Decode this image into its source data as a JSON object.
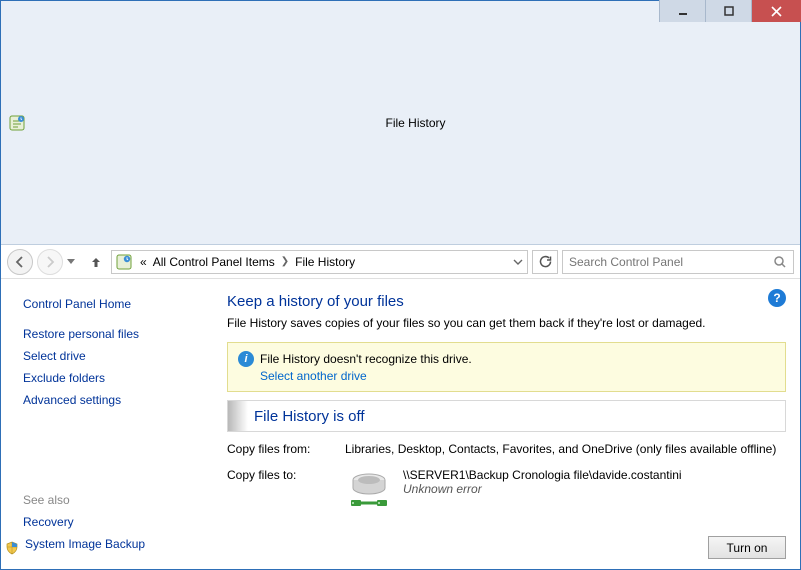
{
  "window": {
    "title": "File History"
  },
  "nav": {
    "crumbs_prefix": "«",
    "crumb1": "All Control Panel Items",
    "crumb2": "File History",
    "search_placeholder": "Search Control Panel"
  },
  "sidebar": {
    "home": "Control Panel Home",
    "links": {
      "restore": "Restore personal files",
      "select_drive": "Select drive",
      "exclude": "Exclude folders",
      "advanced": "Advanced settings"
    },
    "see_also": "See also",
    "recovery": "Recovery",
    "system_image": "System Image Backup"
  },
  "main": {
    "heading": "Keep a history of your files",
    "subtext": "File History saves copies of your files so you can get them back if they're lost or damaged.",
    "warning_text": "File History doesn't recognize this drive.",
    "warning_link": "Select another drive",
    "status": "File History is off",
    "copy_from_label": "Copy files from:",
    "copy_from_value": "Libraries, Desktop, Contacts, Favorites, and OneDrive (only files available offline)",
    "copy_to_label": "Copy files to:",
    "copy_to_path": "\\\\SERVER1\\Backup Cronologia file\\davide.costantini",
    "copy_to_error": "Unknown error",
    "turn_on": "Turn on"
  }
}
